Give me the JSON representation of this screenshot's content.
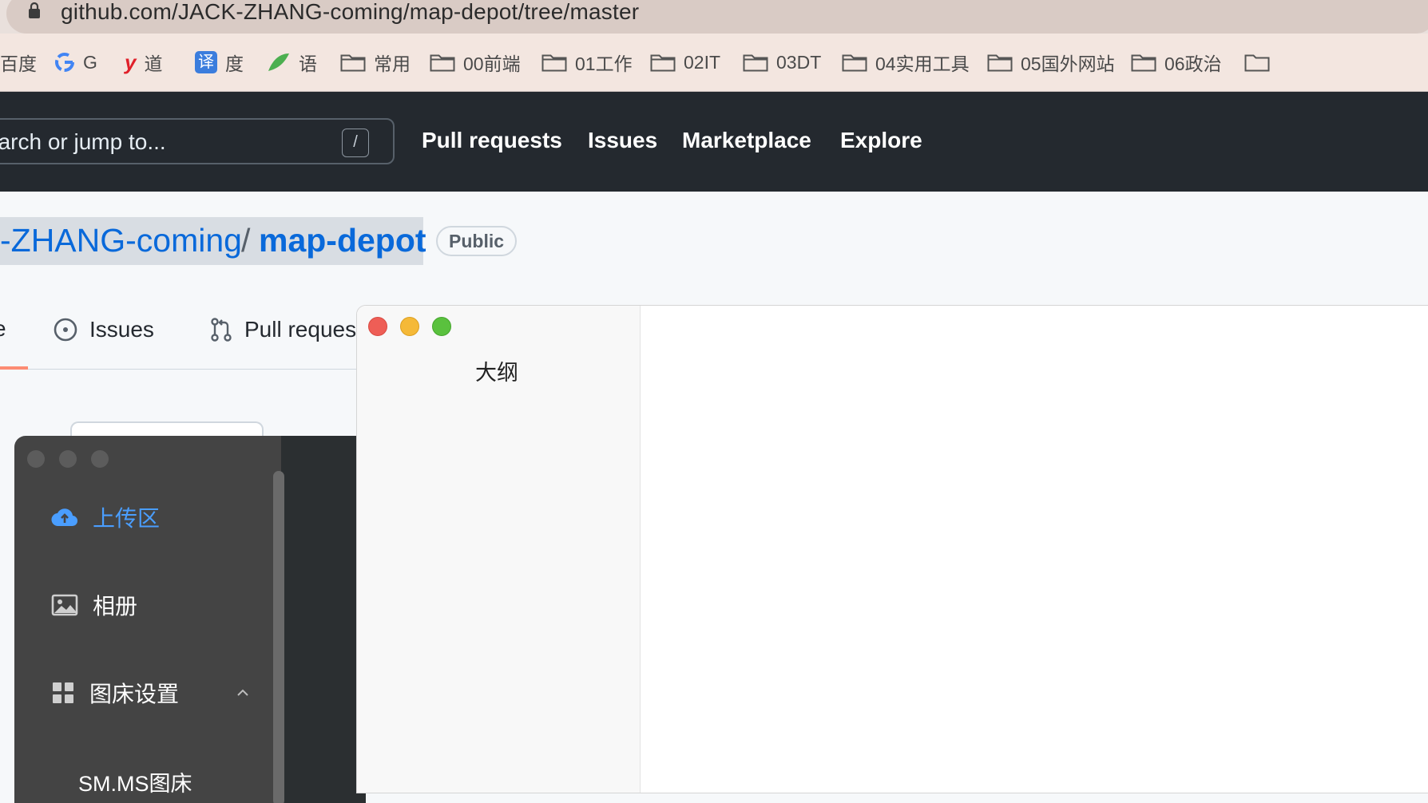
{
  "browser": {
    "url": "github.com/JACK-ZHANG-coming/map-depot/tree/master",
    "bookmarks": [
      {
        "label": "百度",
        "icon": "none"
      },
      {
        "label": "G",
        "icon": "google-icon"
      },
      {
        "label": "道",
        "icon": "youdao-icon"
      },
      {
        "label": "度",
        "icon": "translate-icon"
      },
      {
        "label": "语",
        "icon": "bird-icon"
      },
      {
        "label": "常用",
        "icon": "folder-icon"
      },
      {
        "label": "00前端",
        "icon": "folder-icon"
      },
      {
        "label": "01工作",
        "icon": "folder-icon"
      },
      {
        "label": "02IT",
        "icon": "folder-icon"
      },
      {
        "label": "03DT",
        "icon": "folder-icon"
      },
      {
        "label": "04实用工具",
        "icon": "folder-icon"
      },
      {
        "label": "05国外网站",
        "icon": "folder-icon"
      },
      {
        "label": "06政治",
        "icon": "folder-icon"
      }
    ]
  },
  "github": {
    "search_placeholder": "earch or jump to...",
    "search_shortcut": "/",
    "nav": [
      "Pull requests",
      "Issues",
      "Marketplace",
      "Explore"
    ],
    "repo_owner": "-ZHANG-coming",
    "repo_separator": "/",
    "repo_name": "map-depot",
    "visibility": "Public",
    "tab_partial": "e",
    "tabs": [
      "Issues",
      "Pull reques"
    ]
  },
  "picgo": {
    "menu": [
      {
        "label": "上传区",
        "icon": "cloud-upload-icon",
        "active": true
      },
      {
        "label": "相册",
        "icon": "image-icon",
        "active": false
      },
      {
        "label": "图床设置",
        "icon": "grid-icon",
        "active": false
      }
    ],
    "submenu": [
      "SM.MS图床"
    ]
  },
  "outline_window": {
    "title": "大纲"
  },
  "colors": {
    "github_header": "#24292f",
    "link_blue": "#0969da",
    "picgo_active": "#4a9eff",
    "tab_underline": "#fd8c73"
  }
}
